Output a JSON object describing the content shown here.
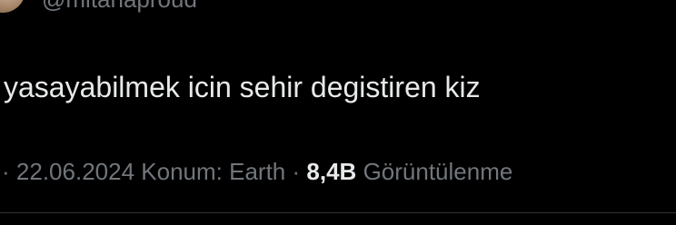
{
  "tweet": {
    "handle": "@mitanaproud",
    "text": "yasayabilmek icin sehir degistiren kiz",
    "meta": {
      "leading_sep": "·",
      "date": "22.06.2024",
      "location": "Konum: Earth",
      "sep": "·",
      "views_count": "8,4B",
      "views_label": "Görüntülenme"
    }
  }
}
